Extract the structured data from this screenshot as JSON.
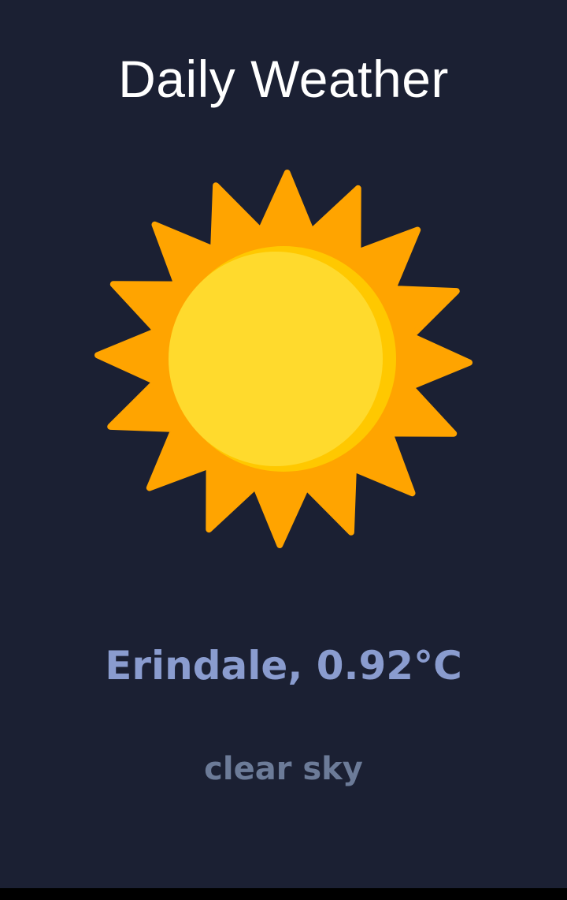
{
  "app": {
    "title": "Daily Weather"
  },
  "weather": {
    "icon": "sun-icon",
    "location_temperature": "Erindale, 0.92°C",
    "description": "clear sky"
  },
  "colors": {
    "background": "#1b2033",
    "title": "#ffffff",
    "location_temperature": "#8a9ccf",
    "description": "#6c7b98",
    "sun_rays": "#ffa400",
    "sun_core": "#ffda2d",
    "sun_core_shade": "#ffc800"
  }
}
